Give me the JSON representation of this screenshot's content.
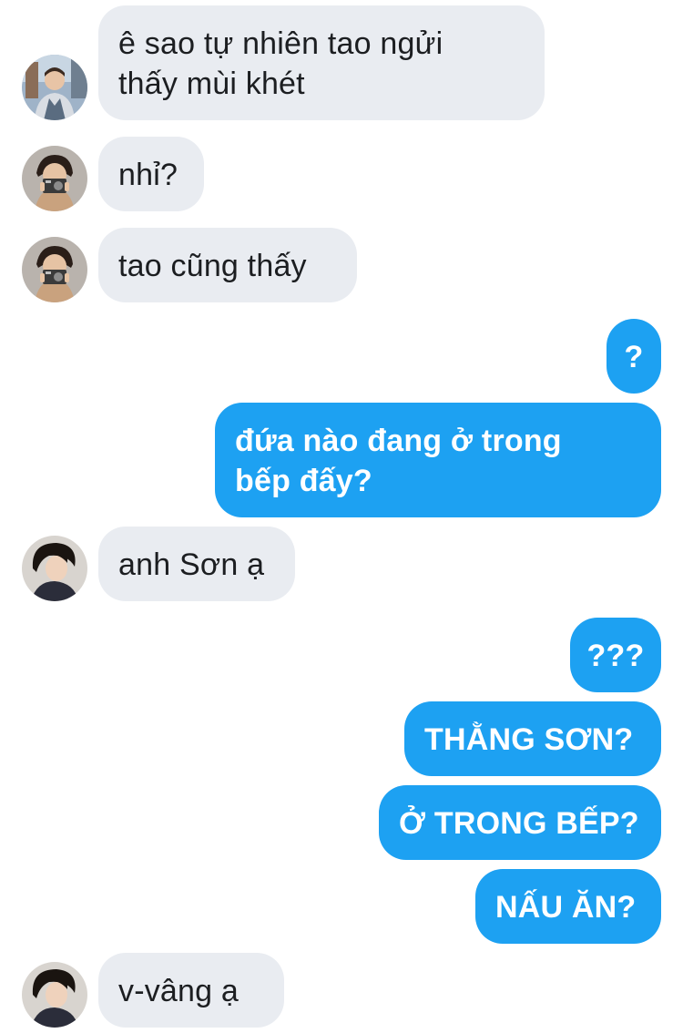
{
  "messages": [
    {
      "direction": "incoming",
      "avatar": "avatar-boy-city-street",
      "text": "ê sao tự nhiên tao ngửi\nthấy mùi khét"
    },
    {
      "direction": "incoming",
      "avatar": "avatar-boy-with-camera",
      "text": "nhỉ?"
    },
    {
      "direction": "incoming",
      "avatar": "avatar-boy-with-camera",
      "text": "tao cũng thấy"
    },
    {
      "direction": "outgoing",
      "text": "?"
    },
    {
      "direction": "outgoing",
      "text": "đứa nào đang ở trong\nbếp đấy?"
    },
    {
      "direction": "incoming",
      "avatar": "avatar-boy-dark-hair",
      "text": "anh Sơn ạ"
    },
    {
      "direction": "outgoing",
      "text": "???"
    },
    {
      "direction": "outgoing",
      "text": "THẰNG SƠN?"
    },
    {
      "direction": "outgoing",
      "text": "Ở TRONG BẾP?"
    },
    {
      "direction": "outgoing",
      "text": "NẤU ĂN?"
    },
    {
      "direction": "incoming",
      "avatar": "avatar-boy-dark-hair",
      "text": "v-vâng ạ"
    }
  ],
  "colors": {
    "incoming_bubble": "#e9ecf1",
    "incoming_text": "#1c1e21",
    "outgoing_bubble": "#1da1f2",
    "outgoing_text": "#ffffff"
  }
}
